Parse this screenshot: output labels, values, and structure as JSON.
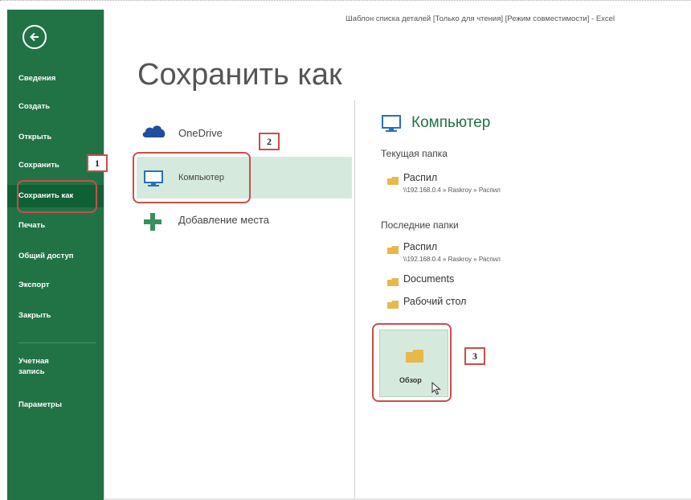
{
  "window": {
    "title": "Шаблон списка деталей [Только для чтения] [Режим совместимости] - Excel"
  },
  "sidebar": {
    "back_icon": "arrow-left-circle-icon",
    "items": [
      {
        "label": "Сведения"
      },
      {
        "label": "Создать"
      },
      {
        "label": "Открыть"
      },
      {
        "label": "Сохранить"
      },
      {
        "label": "Сохранить как",
        "active": true
      },
      {
        "label": "Печать"
      },
      {
        "label": "Общий доступ"
      },
      {
        "label": "Экспорт"
      },
      {
        "label": "Закрыть"
      },
      {
        "label_line1": "Учетная",
        "label_line2": "запись"
      },
      {
        "label": "Параметры"
      }
    ]
  },
  "main": {
    "title": "Сохранить как",
    "places": [
      {
        "label": "OneDrive",
        "icon": "cloud-icon"
      },
      {
        "label": "Компьютер",
        "icon": "monitor-icon",
        "selected": true
      },
      {
        "label": "Добавление места",
        "icon": "plus-icon"
      }
    ]
  },
  "right": {
    "heading": "Компьютер",
    "current_label": "Текущая папка",
    "current_folder": {
      "name": "Распил",
      "path": "\\\\192.168.0.4 » Raskroy » Распил"
    },
    "recent_label": "Последние папки",
    "recent_folders": [
      {
        "name": "Распил",
        "path": "\\\\192.168.0.4 » Raskroy » Распил"
      },
      {
        "name": "Documents"
      },
      {
        "name": "Рабочий стол"
      }
    ],
    "browse_label": "Обзор"
  },
  "annotations": {
    "step1": "1",
    "step2": "2",
    "step3": "3"
  },
  "colors": {
    "sidebar": "#217346",
    "sidebar_active": "#106035",
    "selected_bg": "#d5eadc",
    "accent": "#217346",
    "highlight": "#c94d4d"
  }
}
